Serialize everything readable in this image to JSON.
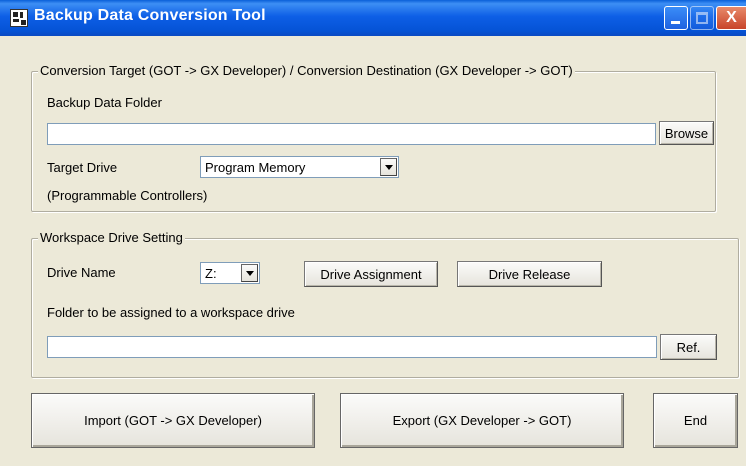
{
  "window": {
    "title": "Backup Data Conversion Tool",
    "title_bar_color": "#0A5FD8",
    "controls": {
      "minimize_icon": "minimize-icon",
      "maximize_icon": "maximize-icon",
      "close_icon": "close-icon",
      "close_glyph": "X"
    }
  },
  "conversion_group": {
    "legend": "Conversion Target (GOT -> GX Developer) / Conversion Destination (GX Developer -> GOT)",
    "backup_folder_label": "Backup Data Folder",
    "backup_folder_value": "",
    "browse_label": "Browse",
    "target_drive_label": "Target Drive",
    "target_drive_value": "Program Memory",
    "target_drive_note": "(Programmable Controllers)"
  },
  "workspace_group": {
    "legend": "Workspace Drive Setting",
    "drive_name_label": "Drive Name",
    "drive_name_value": "Z:",
    "drive_assignment_label": "Drive Assignment",
    "drive_release_label": "Drive Release",
    "folder_label": "Folder to be assigned to a workspace drive",
    "folder_value": "",
    "ref_label": "Ref."
  },
  "actions": {
    "import_label": "Import (GOT -> GX Developer)",
    "export_label": "Export (GX Developer -> GOT)",
    "end_label": "End"
  }
}
